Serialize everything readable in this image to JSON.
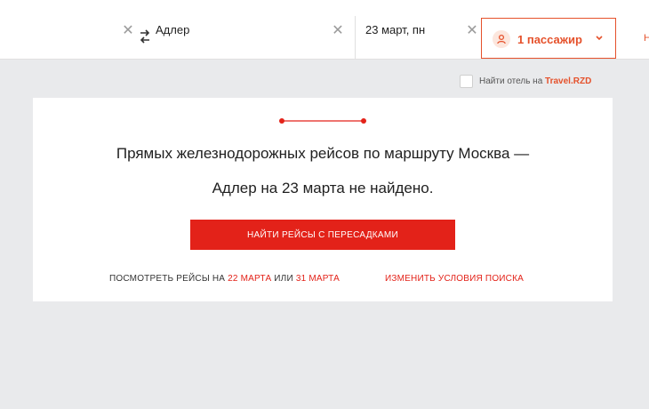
{
  "search": {
    "to_value": "Адлер",
    "date_value": "23 март, пн",
    "passengers_label": "1 пассажир",
    "edge_text": "Н"
  },
  "hotel": {
    "text": "Найти отель на",
    "brand": "Travel.RZD"
  },
  "result": {
    "message_line1": "Прямых железнодорожных рейсов по маршруту Москва —",
    "message_line2": "Адлер на 23 марта не найдено.",
    "transfer_button": "НАЙТИ РЕЙСЫ С ПЕРЕСАДКАМИ",
    "see_prefix": "ПОСМОТРЕТЬ РЕЙСЫ НА",
    "date_link_1": "22 МАРТА",
    "or_text": "ИЛИ",
    "date_link_2": "31 МАРТА",
    "change_link": "ИЗМЕНИТЬ УСЛОВИЯ ПОИСКА"
  },
  "colors": {
    "accent": "#e32219",
    "accent_orange": "#e5512b",
    "background": "#e9eaec"
  }
}
